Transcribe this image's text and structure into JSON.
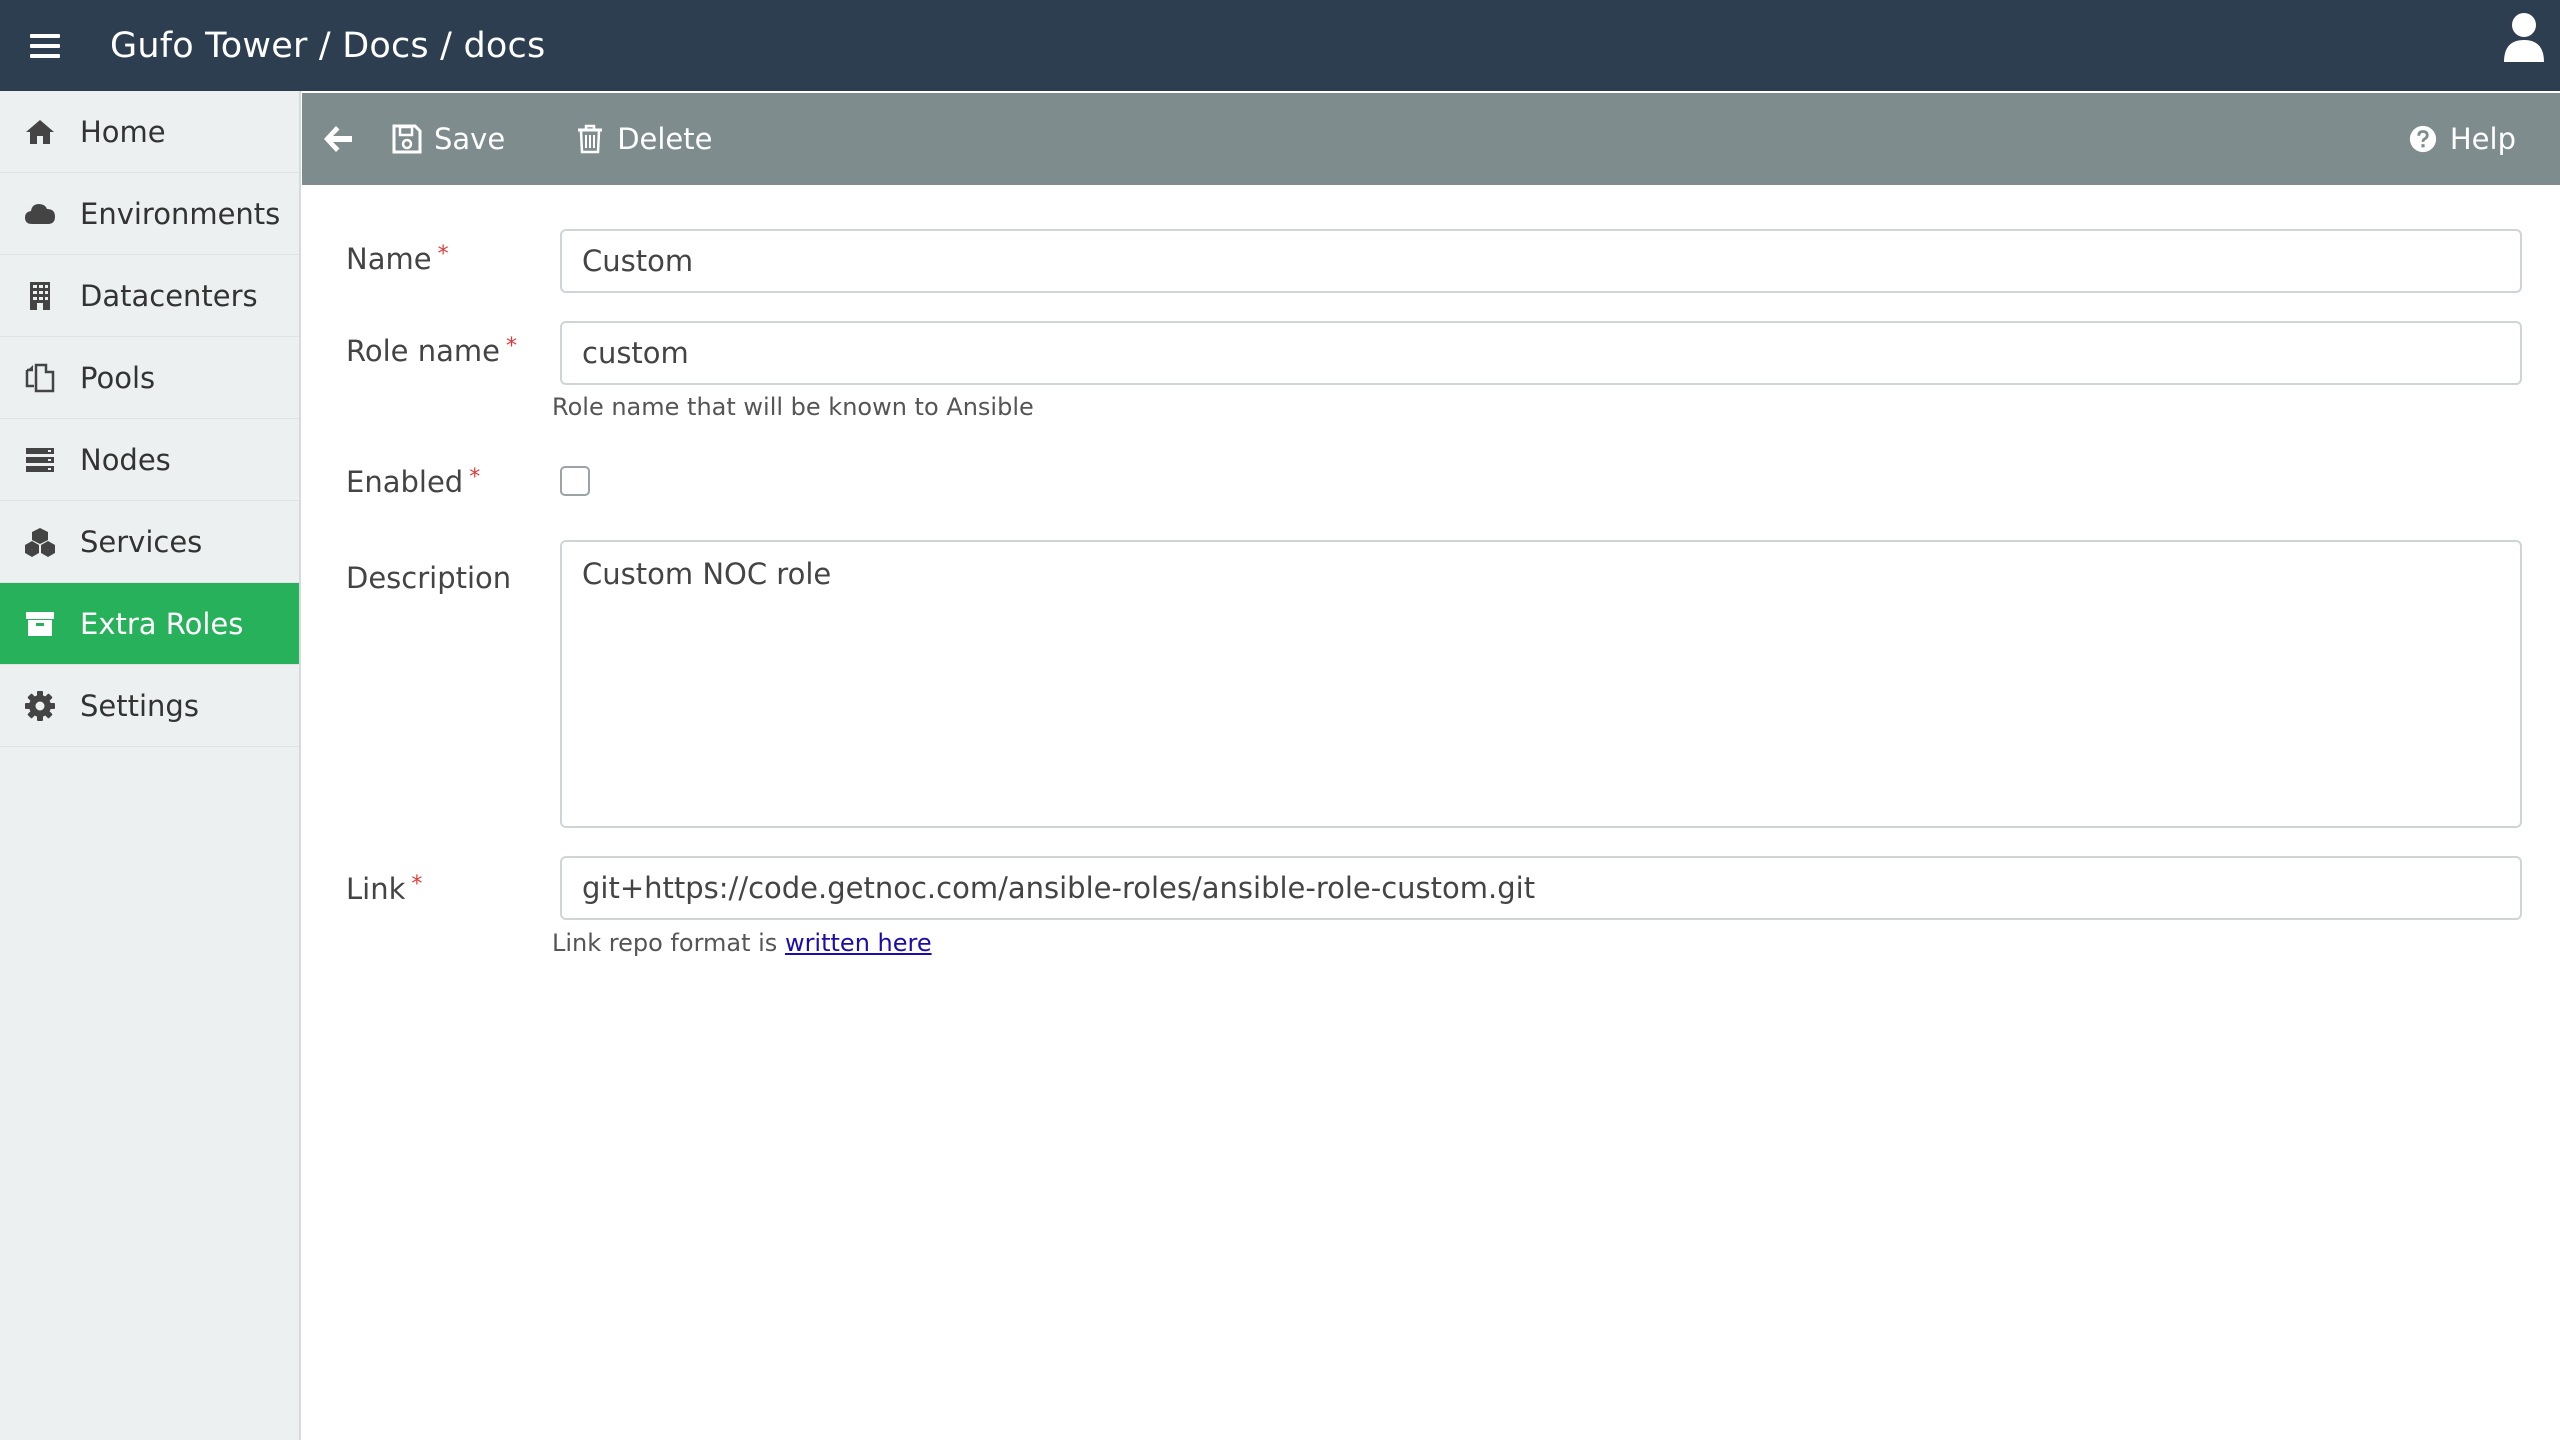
{
  "header": {
    "title": "Gufo Tower / Docs / docs",
    "menu_icon": "hamburger-icon",
    "user_icon": "user-icon"
  },
  "sidebar": {
    "items": [
      {
        "label": "Home",
        "icon": "home-icon"
      },
      {
        "label": "Environments",
        "icon": "cloud-icon"
      },
      {
        "label": "Datacenters",
        "icon": "building-icon"
      },
      {
        "label": "Pools",
        "icon": "copy-icon"
      },
      {
        "label": "Nodes",
        "icon": "server-icon"
      },
      {
        "label": "Services",
        "icon": "cubes-icon"
      },
      {
        "label": "Extra Roles",
        "icon": "archive-icon",
        "active": true
      },
      {
        "label": "Settings",
        "icon": "gear-icon"
      }
    ]
  },
  "toolbar": {
    "save_label": "Save",
    "delete_label": "Delete",
    "help_label": "Help"
  },
  "form": {
    "name": {
      "label": "Name",
      "value": "Custom"
    },
    "role_name": {
      "label": "Role name",
      "value": "custom",
      "help": "Role name that will be known to Ansible"
    },
    "enabled": {
      "label": "Enabled",
      "checked": false
    },
    "description": {
      "label": "Description",
      "value": "Custom NOC role"
    },
    "link": {
      "label": "Link",
      "value": "git+https://code.getnoc.com/ansible-roles/ansible-role-custom.git",
      "help_prefix": "Link repo format is ",
      "help_link": "written here"
    },
    "required_marker": "*"
  },
  "colors": {
    "topbar": "#2c3e50",
    "toolbar": "#7f8c8d",
    "sidebar": "#ecf0f1",
    "active": "#27b15b",
    "required": "#e03a3a"
  }
}
